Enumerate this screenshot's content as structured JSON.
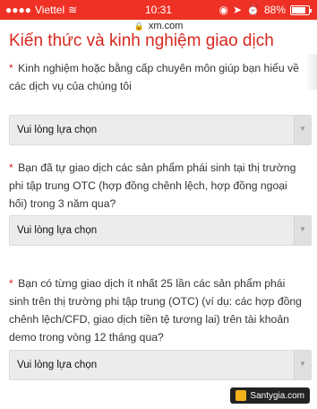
{
  "status_bar": {
    "carrier": "Viettel",
    "time": "10:31",
    "battery": "88%"
  },
  "url_bar": {
    "url": "xm.com"
  },
  "page": {
    "title": "Kiến thức và kinh nghiệm giao dịch",
    "questions": [
      {
        "text": "Kinh nghiệm hoặc bằng cấp chuyên môn giúp bạn hiểu về các dịch vụ của chúng tôi",
        "select_value": "Vui lòng lựa chọn"
      },
      {
        "text": "Bạn đã tự giao dịch các sản phẩm phái sinh tại thị trường phi tập trung OTC (hợp đồng chênh lệch, hợp đồng ngoại hối) trong 3 năm qua?",
        "select_value": "Vui lòng lựa chọn"
      },
      {
        "text": "Bạn có từng giao dịch ít nhất 25 lần các sản phẩm phái sinh trên thị trường phi tập trung (OTC) (ví dụ: các hợp đồng chênh lệch/CFD, giao dịch tiền tệ tương lai) trên tài khoản demo trong vòng 12 tháng qua?",
        "select_value": "Vui lòng lựa chọn"
      }
    ]
  },
  "watermark": {
    "text": "Santygia.com"
  }
}
